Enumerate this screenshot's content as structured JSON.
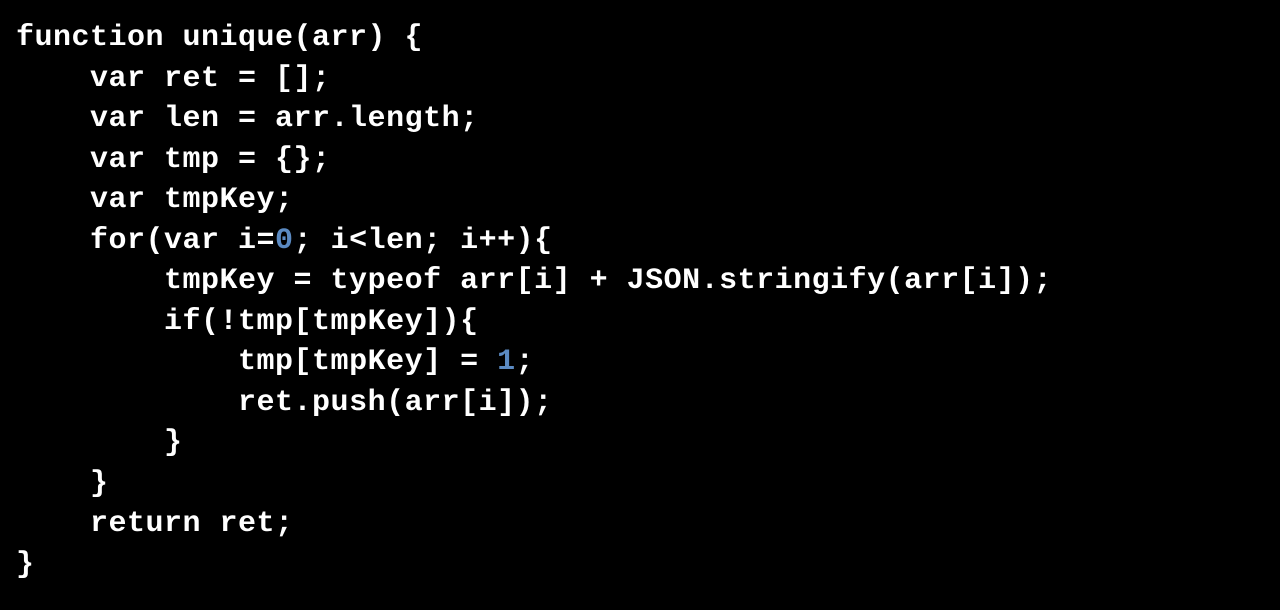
{
  "code": {
    "lines": [
      {
        "indent": 0,
        "segments": [
          {
            "t": "function unique(arr) {"
          }
        ]
      },
      {
        "indent": 1,
        "segments": [
          {
            "t": "var ret = [];"
          }
        ]
      },
      {
        "indent": 1,
        "segments": [
          {
            "t": "var len = arr.length;"
          }
        ]
      },
      {
        "indent": 1,
        "segments": [
          {
            "t": "var tmp = {};"
          }
        ]
      },
      {
        "indent": 1,
        "segments": [
          {
            "t": "var tmpKey;"
          }
        ]
      },
      {
        "indent": 1,
        "segments": [
          {
            "t": "for(var i="
          },
          {
            "t": "0",
            "cls": "num"
          },
          {
            "t": "; i<len; i++){"
          }
        ]
      },
      {
        "indent": 2,
        "segments": [
          {
            "t": "tmpKey = typeof arr[i] + JSON.stringify(arr[i]);"
          }
        ]
      },
      {
        "indent": 2,
        "segments": [
          {
            "t": "if(!tmp[tmpKey]){"
          }
        ]
      },
      {
        "indent": 3,
        "segments": [
          {
            "t": "tmp[tmpKey] = "
          },
          {
            "t": "1",
            "cls": "num"
          },
          {
            "t": ";"
          }
        ]
      },
      {
        "indent": 3,
        "segments": [
          {
            "t": "ret.push(arr[i]);"
          }
        ]
      },
      {
        "indent": 2,
        "segments": [
          {
            "t": "}"
          }
        ]
      },
      {
        "indent": 1,
        "segments": [
          {
            "t": "}"
          }
        ]
      },
      {
        "indent": 1,
        "segments": [
          {
            "t": "return ret;"
          }
        ]
      },
      {
        "indent": 0,
        "segments": [
          {
            "t": "}"
          }
        ]
      }
    ],
    "indent_unit": "    "
  }
}
